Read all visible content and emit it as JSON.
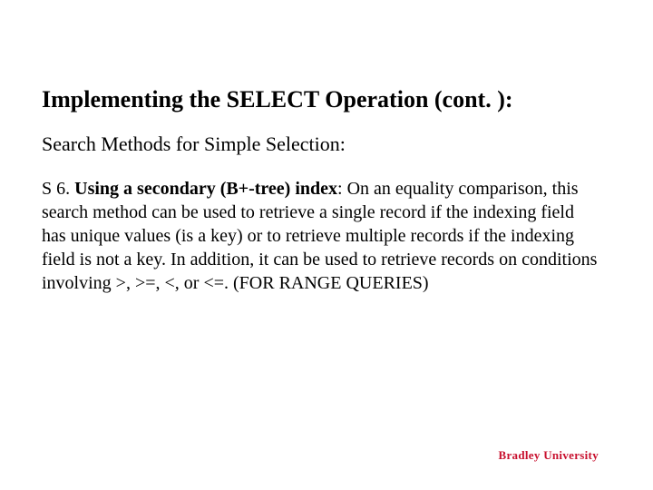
{
  "title": "Implementing the SELECT Operation (cont. ):",
  "subtitle": "Search Methods for Simple Selection:",
  "body": {
    "lead_prefix": "S 6. ",
    "lead_bold": "Using a secondary (B+-tree) index",
    "rest": ": On an equality comparison, this search method can be used to retrieve a single record if the indexing field has unique values (is a key) or to retrieve multiple records if the indexing field is not a key. In addition, it can be used to retrieve records on conditions involving >, >=, <, or <=. (FOR RANGE QUERIES)"
  },
  "footer": "Bradley University"
}
